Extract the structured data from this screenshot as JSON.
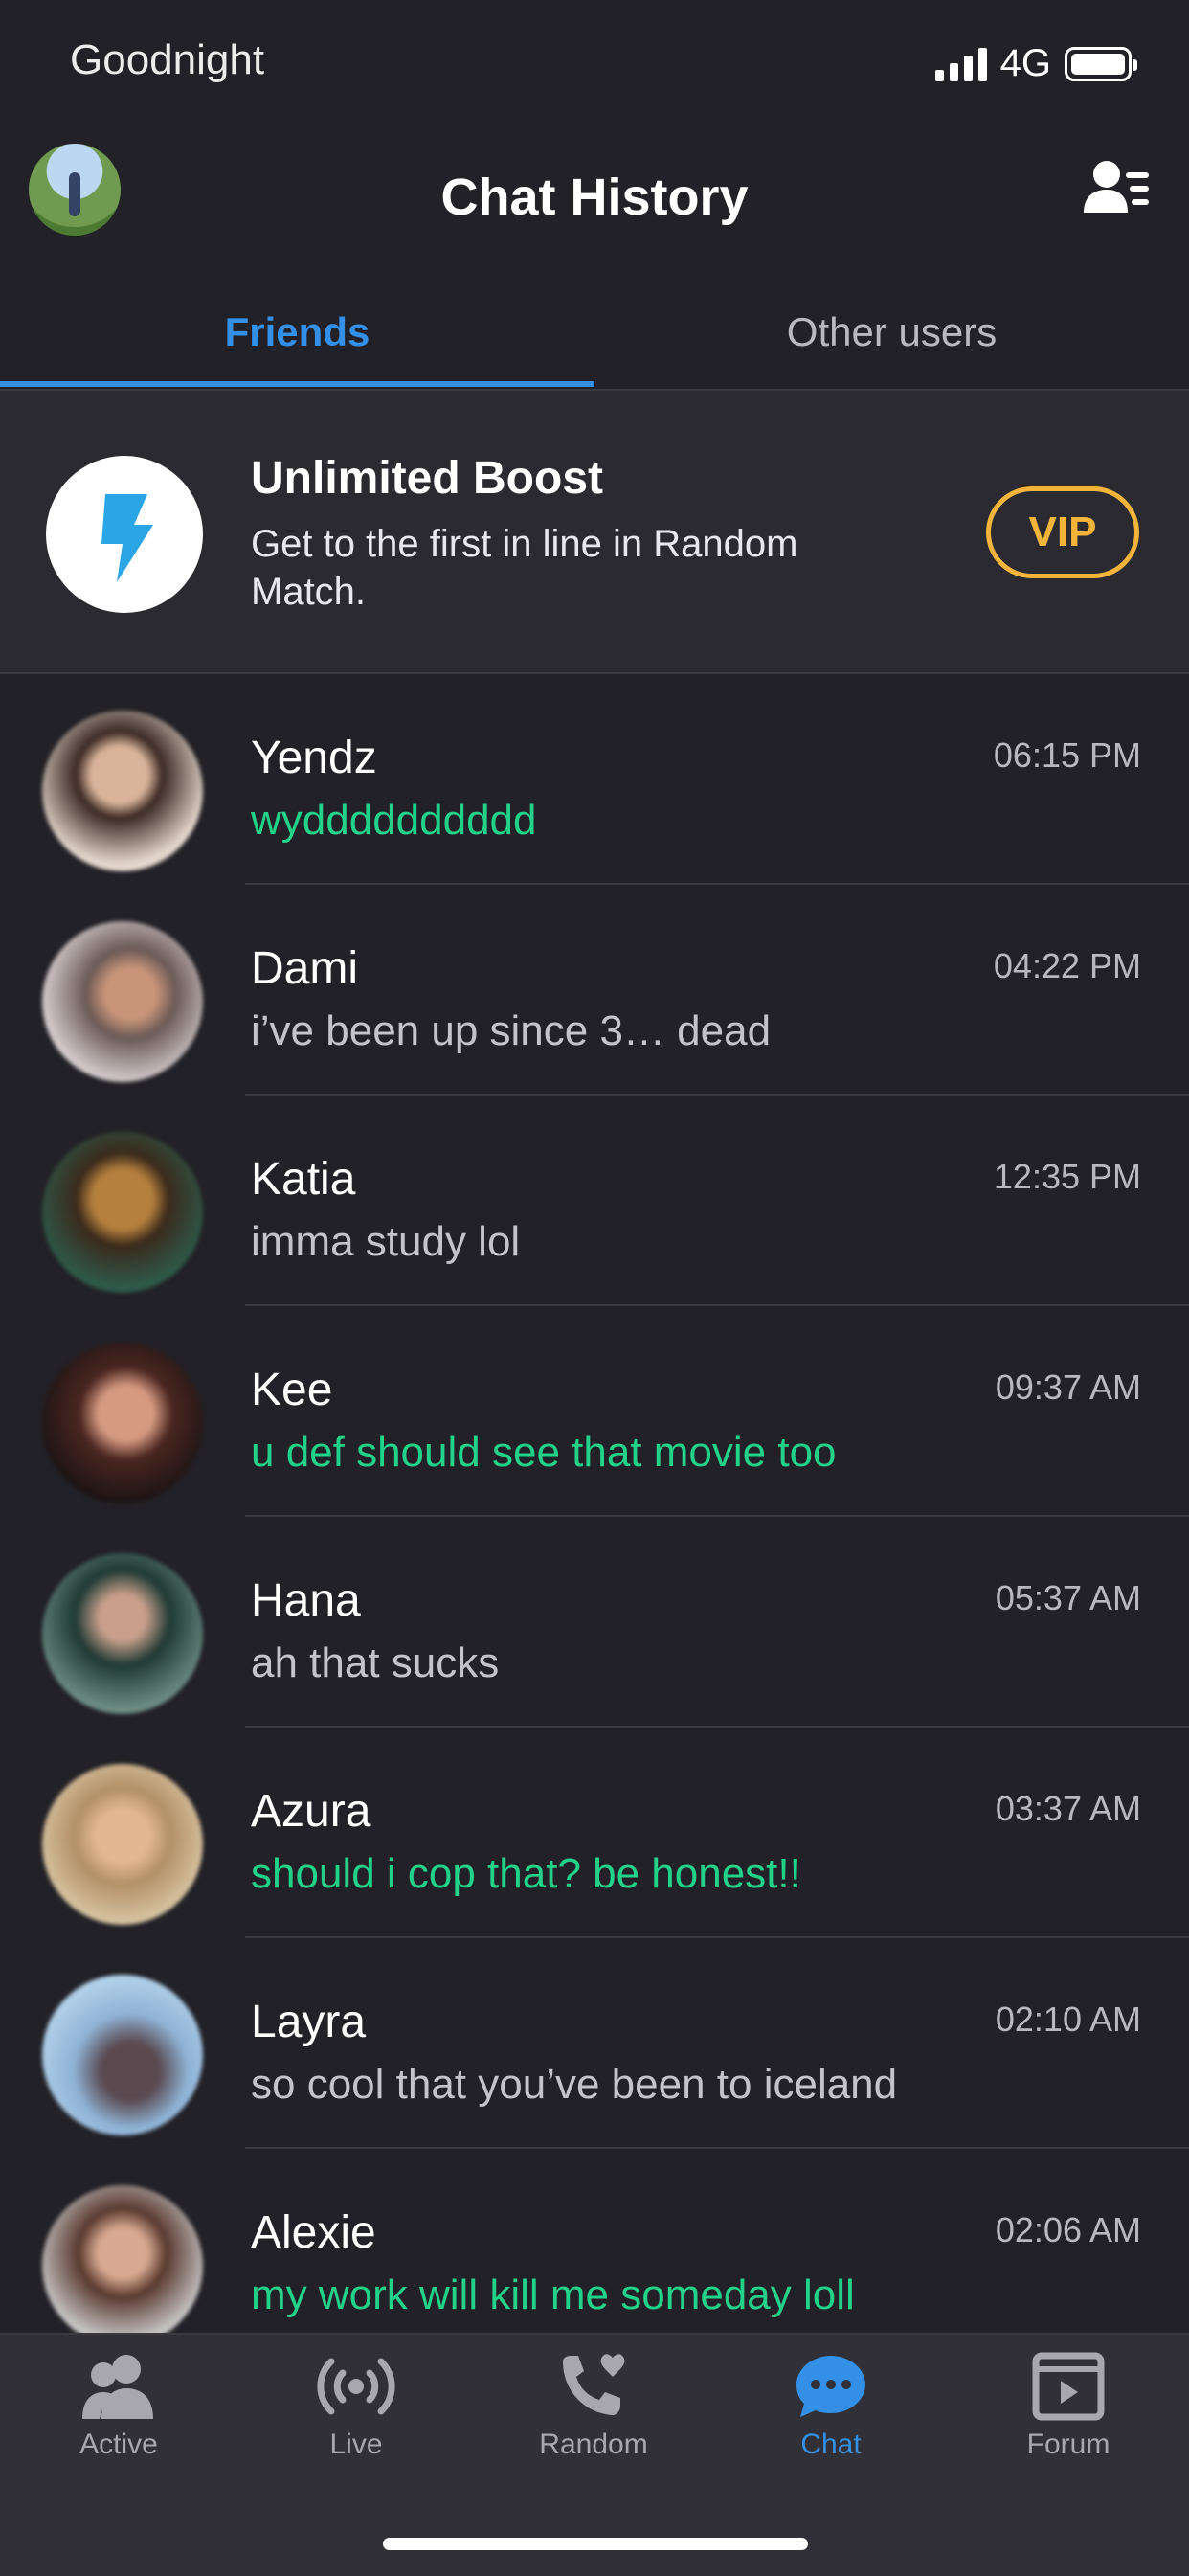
{
  "status_bar": {
    "carrier": "Goodnight",
    "network": "4G"
  },
  "header": {
    "title": "Chat History"
  },
  "tabs": [
    {
      "label": "Friends",
      "active": true
    },
    {
      "label": "Other users",
      "active": false
    }
  ],
  "boost": {
    "title": "Unlimited Boost",
    "description": "Get to the first in line in Random Match.",
    "vip_label": "VIP"
  },
  "chats": [
    {
      "name": "Yendz",
      "message": "wydddddddddd",
      "time": "06:15 PM",
      "unread": true
    },
    {
      "name": "Dami",
      "message": "i’ve been up since 3… dead",
      "time": "04:22 PM",
      "unread": false
    },
    {
      "name": "Katia",
      "message": "imma study lol",
      "time": "12:35 PM",
      "unread": false
    },
    {
      "name": "Kee",
      "message": "u def should see that movie too",
      "time": "09:37 AM",
      "unread": true
    },
    {
      "name": "Hana",
      "message": "ah that sucks",
      "time": "05:37 AM",
      "unread": false
    },
    {
      "name": "Azura",
      "message": "should i cop that? be honest!!",
      "time": "03:37 AM",
      "unread": true
    },
    {
      "name": "Layra",
      "message": "so cool that you’ve been to iceland",
      "time": "02:10 AM",
      "unread": false
    },
    {
      "name": "Alexie",
      "message": "my work will kill me someday loll",
      "time": "02:06 AM",
      "unread": true
    }
  ],
  "bottom_nav": [
    {
      "label": "Active",
      "icon": "users-icon",
      "active": false
    },
    {
      "label": "Live",
      "icon": "broadcast-icon",
      "active": false
    },
    {
      "label": "Random",
      "icon": "phone-heart-icon",
      "active": false
    },
    {
      "label": "Chat",
      "icon": "chat-bubble-icon",
      "active": true
    },
    {
      "label": "Forum",
      "icon": "forum-icon",
      "active": false
    }
  ],
  "colors": {
    "background": "#222127",
    "accent": "#3390e6",
    "unread_message": "#22d18a",
    "vip": "#f3b43c",
    "nav_bar": "#303036"
  }
}
